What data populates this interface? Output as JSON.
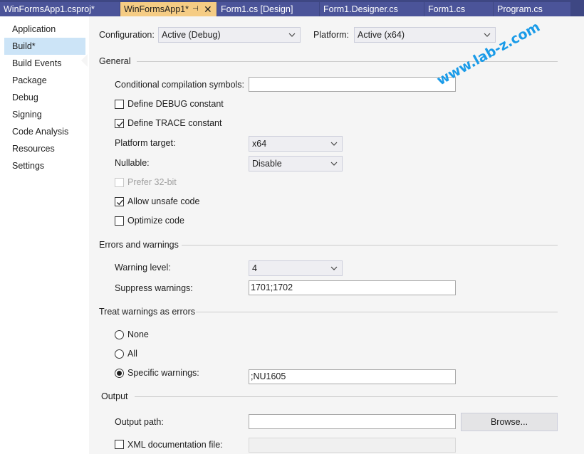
{
  "tabs": [
    {
      "label": "WinFormsApp1.csproj*"
    },
    {
      "label": "WinFormsApp1*"
    },
    {
      "label": "Form1.cs [Design]"
    },
    {
      "label": "Form1.Designer.cs"
    },
    {
      "label": "Form1.cs"
    },
    {
      "label": "Program.cs"
    }
  ],
  "tab_pin_glyph": "⊣",
  "tab_close_glyph": "✕",
  "nav": {
    "items": [
      "Application",
      "Build*",
      "Build Events",
      "Package",
      "Debug",
      "Signing",
      "Code Analysis",
      "Resources",
      "Settings"
    ]
  },
  "config": {
    "configuration_label": "Configuration:",
    "configuration_value": "Active (Debug)",
    "platform_label": "Platform:",
    "platform_value": "Active (x64)"
  },
  "general": {
    "header": "General",
    "cond_symbols_label": "Conditional compilation symbols:",
    "cond_symbols_value": "",
    "define_debug": "Define DEBUG constant",
    "define_trace": "Define TRACE constant",
    "platform_target_label": "Platform target:",
    "platform_target_value": "x64",
    "nullable_label": "Nullable:",
    "nullable_value": "Disable",
    "prefer32": "Prefer 32-bit",
    "allow_unsafe": "Allow unsafe code",
    "optimize": "Optimize code"
  },
  "errors": {
    "header": "Errors and warnings",
    "warning_level_label": "Warning level:",
    "warning_level_value": "4",
    "suppress_label": "Suppress warnings:",
    "suppress_value": "1701;1702"
  },
  "treat": {
    "header": "Treat warnings as errors",
    "none": "None",
    "all": "All",
    "specific": "Specific warnings:",
    "specific_value": ";NU1605"
  },
  "output": {
    "header": "Output",
    "path_label": "Output path:",
    "path_value": "",
    "browse": "Browse...",
    "xml_doc": "XML documentation file:"
  },
  "watermark": "www.lab-z.com",
  "colors": {
    "tabbar": "#3e4783",
    "active_tab": "#f5cc84",
    "nav_selected": "#cce4f7",
    "watermark": "#1a9be8"
  }
}
